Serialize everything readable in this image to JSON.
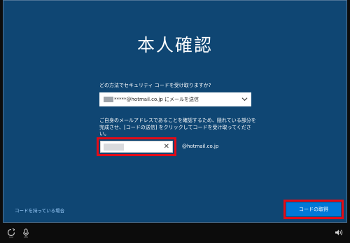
{
  "page": {
    "title": "本人確認",
    "question": "どの方法でセキュリティ コードを受け取りますか?",
    "dropdown": {
      "selected": "*****@hotmail.co.jp にメールを送信"
    },
    "instruction": "ご自身のメールアドレスであることを確認するため、隠れている部分を完成させ、[コードの送信] をクリックしてコードを受け取ってください。",
    "email": {
      "domain": "@hotmail.co.jp",
      "clear_glyph": "✕"
    },
    "have_code_link": "コードを持っている場合",
    "send_button": "コードの取得"
  },
  "colors": {
    "background": "#0f4673",
    "button": "#0078d7",
    "highlight": "#e30b17",
    "link": "#9fd0ff"
  },
  "icons": {
    "dropdown": "chevron-down-icon",
    "taskbar_left": [
      "ease-of-access-icon",
      "microphone-icon"
    ],
    "taskbar_right": "volume-icon"
  }
}
